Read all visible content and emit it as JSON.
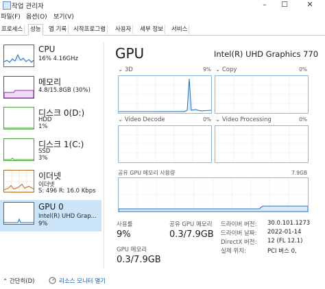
{
  "window": {
    "title": "작업 관리자",
    "minimize": "–",
    "maximize": "☐",
    "close": "✕"
  },
  "menu": [
    "파일(F)",
    "옵션(O)",
    "보기(V)"
  ],
  "tabs": [
    "프로세스",
    "성능",
    "앱 기록",
    "시작프로그램",
    "사용자",
    "세부 정보",
    "서비스"
  ],
  "active_tab": "성능",
  "sidebar": [
    {
      "name": "CPU",
      "sub1": "16% 4.16GHz",
      "sub2": "",
      "color": "#1a6fc2"
    },
    {
      "name": "메모리",
      "sub1": "4.8/15.8GB (30%)",
      "sub2": "",
      "color": "#8b2fa8"
    },
    {
      "name": "디스크 0(D:)",
      "sub1": "HDD",
      "sub2": "1%",
      "color": "#4aa33a"
    },
    {
      "name": "디스크 1(C:)",
      "sub1": "SSD",
      "sub2": "3%",
      "color": "#4aa33a"
    },
    {
      "name": "이더넷",
      "sub1": "이더넷",
      "sub2": "S: 496  R: 16.0 Kbps",
      "color": "#b5651d"
    },
    {
      "name": "GPU 0",
      "sub1": "Intel(R) UHD Grap...",
      "sub2": "9%",
      "color": "#1a6fc2"
    }
  ],
  "main": {
    "title": "GPU",
    "model": "Intel(R) UHD Graphics 770",
    "graphs": [
      {
        "label": "3D",
        "pct": "9%"
      },
      {
        "label": "Copy",
        "pct": "0%"
      },
      {
        "label": "Video Decode",
        "pct": "0%"
      },
      {
        "label": "Video Processing",
        "pct": "0%"
      }
    ],
    "shared_mem_graph": {
      "label": "공유 GPU 메모리 사용량",
      "max": "7.9GB"
    },
    "stats": [
      {
        "label": "사용률",
        "value": "9%"
      },
      {
        "label": "공유 GPU 메모리",
        "value": "0.3/7.9GB"
      },
      {
        "label": "GPU 메모리",
        "value": "0.3/7.9GB"
      }
    ],
    "info": [
      {
        "k": "드라이버 버전:",
        "v": "30.0.101.1273"
      },
      {
        "k": "드라이버 날짜:",
        "v": "2022-01-14"
      },
      {
        "k": "DirectX 버전:",
        "v": "12 (FL 12.1)"
      },
      {
        "k": "실제 위치:",
        "v": "PCI 버스 0,"
      }
    ]
  },
  "footer": {
    "summary": "간단히(D)",
    "monitor_link": "리소스 모니터 열기"
  },
  "colors": {
    "accent": "#1a6fc2",
    "graph_border": "#8fb7dd",
    "selected_bg": "#cce4f7"
  }
}
